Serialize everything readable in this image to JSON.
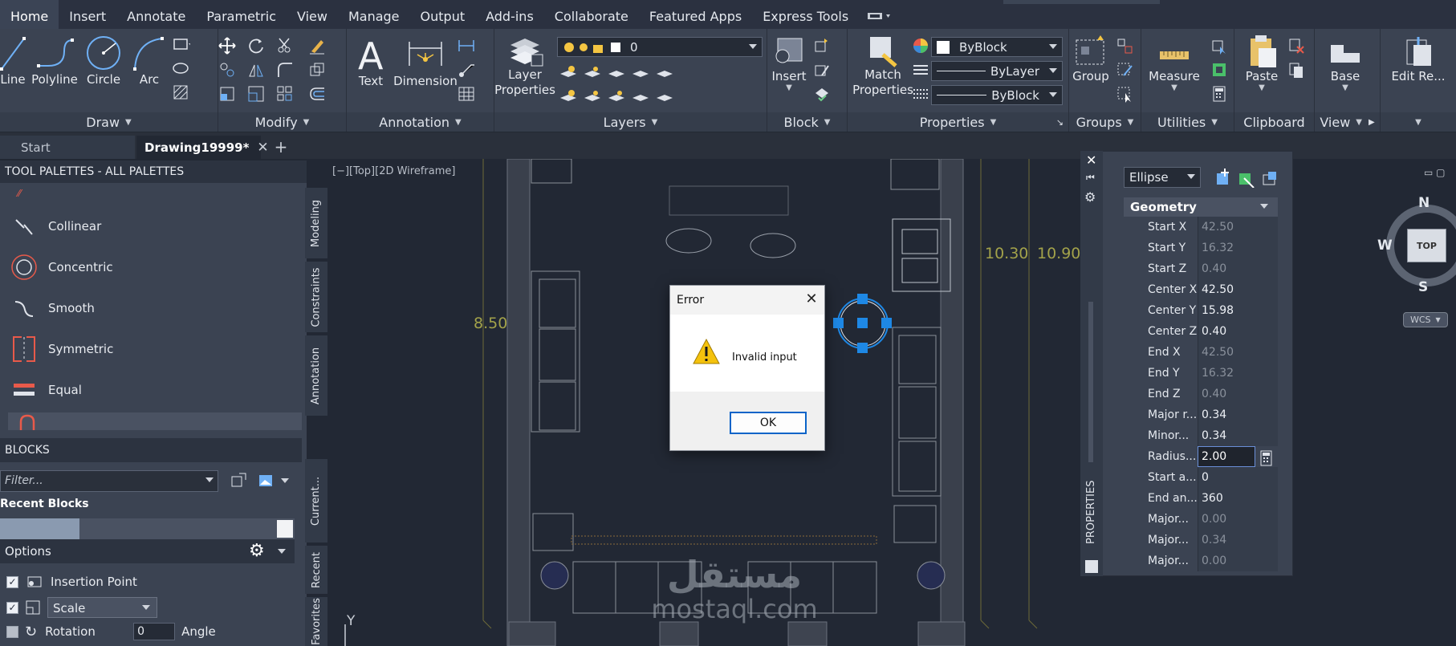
{
  "menu": [
    "Home",
    "Insert",
    "Annotate",
    "Parametric",
    "View",
    "Manage",
    "Output",
    "Add-ins",
    "Collaborate",
    "Featured Apps",
    "Express Tools"
  ],
  "ribbon": {
    "draw": {
      "title": "Draw",
      "tools": [
        "Line",
        "Polyline",
        "Circle",
        "Arc"
      ]
    },
    "modify": {
      "title": "Modify"
    },
    "annotation": {
      "title": "Annotation",
      "tools": [
        "Text",
        "Dimension"
      ]
    },
    "layers": {
      "title": "Layers",
      "layer_props": "Layer Properties",
      "current_layer": "0"
    },
    "block": {
      "title": "Block",
      "insert": "Insert"
    },
    "properties": {
      "title": "Properties",
      "match": "Match Properties",
      "color": "ByBlock",
      "linetype": "ByLayer",
      "lineweight": "ByBlock"
    },
    "groups": {
      "title": "Groups",
      "group": "Group"
    },
    "utilities": {
      "title": "Utilities",
      "measure": "Measure"
    },
    "clipboard": {
      "title": "Clipboard",
      "paste": "Paste"
    },
    "view": {
      "title": "View",
      "base": "Base"
    },
    "edit": {
      "label": "Edit Re..."
    }
  },
  "doc_tabs": {
    "start": "Start",
    "drawing": "Drawing19999*"
  },
  "palette": {
    "title": "TOOL PALETTES - ALL PALETTES",
    "items": [
      "Collinear",
      "Concentric",
      "Smooth",
      "Symmetric",
      "Equal"
    ],
    "side_tabs": [
      "Modeling",
      "Constraints",
      "Annotation"
    ],
    "side_tabs2": [
      "Current...",
      "Recent",
      "Favorites"
    ]
  },
  "blocks": {
    "title": "BLOCKS",
    "filter_placeholder": "Filter...",
    "recent": "Recent Blocks",
    "options": "Options",
    "insertion_point": "Insertion Point",
    "scale": "Scale",
    "rotation": "Rotation",
    "rotation_value": "0",
    "angle": "Angle"
  },
  "viewport": {
    "label": "[−][Top][2D Wireframe]"
  },
  "dims": {
    "left": "8.50",
    "right1": "10.30",
    "right2": "10.90"
  },
  "properties": {
    "object": "Ellipse",
    "section": "Geometry",
    "strip_label": "PROPERTIES",
    "rows": [
      {
        "name": "Start X",
        "value": "42.50",
        "ro": true
      },
      {
        "name": "Start Y",
        "value": "16.32",
        "ro": true
      },
      {
        "name": "Start Z",
        "value": "0.40",
        "ro": true
      },
      {
        "name": "Center X",
        "value": "42.50",
        "ro": false
      },
      {
        "name": "Center Y",
        "value": "15.98",
        "ro": false
      },
      {
        "name": "Center Z",
        "value": "0.40",
        "ro": false
      },
      {
        "name": "End X",
        "value": "42.50",
        "ro": true
      },
      {
        "name": "End Y",
        "value": "16.32",
        "ro": true
      },
      {
        "name": "End Z",
        "value": "0.40",
        "ro": true
      },
      {
        "name": "Major r...",
        "value": "0.34",
        "ro": false
      },
      {
        "name": "Minor...",
        "value": "0.34",
        "ro": false
      },
      {
        "name": "Radius...",
        "value": "2.00",
        "ro": false,
        "edit": true
      },
      {
        "name": "Start a...",
        "value": "0",
        "ro": false
      },
      {
        "name": "End an...",
        "value": "360",
        "ro": false
      },
      {
        "name": "Major...",
        "value": "0.00",
        "ro": true
      },
      {
        "name": "Major...",
        "value": "0.34",
        "ro": true
      },
      {
        "name": "Major...",
        "value": "0.00",
        "ro": true
      }
    ]
  },
  "dialog": {
    "title": "Error",
    "message": "Invalid input",
    "ok": "OK"
  },
  "compass": {
    "n": "N",
    "s": "S",
    "w": "W",
    "top": "TOP",
    "wcs": "WCS"
  },
  "watermark": {
    "arabic": "مستقل",
    "latin": "mostaql.com"
  },
  "ucs": {
    "y": "Y"
  },
  "colors": {
    "accent": "#0a64c8",
    "grip": "#1e88e5",
    "dim_text": "#a3a24a"
  }
}
